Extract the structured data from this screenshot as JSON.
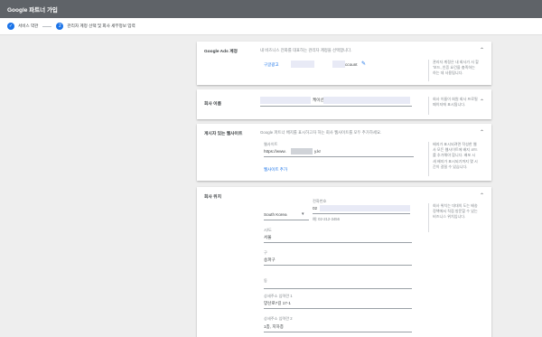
{
  "header": {
    "title": "Google 파트너 가입"
  },
  "steps": [
    {
      "num": "✓",
      "label": "서비스 약관"
    },
    {
      "num": "2",
      "label": "관리자 계정 선택 및 회사 세부정보 입력"
    }
  ],
  "ads_account": {
    "title": "Google Ads 계정",
    "desc": "내 비즈니스 전화를 대표하는 관리자 계정을 선택합니다.",
    "account_prefix": "구글광고",
    "account_suffix": "ccount",
    "help": "관리자 계정은 내 회사가 사 할 ‘보드, 인증 요건을 충족하는 하는 데 사용됩니다."
  },
  "company_name": {
    "title": "회사 이름",
    "value": "케이션",
    "help": "회사 이름이 회원 회사 프로필 페이지에 표시됩니다."
  },
  "websites": {
    "title": "게시자 있는 웹사이트",
    "desc": "Google 파트너 배지를 표시하고자 하는 회사 웹사이트를 모두 추가하세요.",
    "field_label": "웹사이트",
    "url_prefix": "https://www.",
    "url_suffix": "y.kr",
    "add_link": "웹사이트 추가",
    "help": "배지가 표시되려면 작성한 웹 사 모든 웹사이트에 배지 코드를 추가해야 합니다. 배포 시 새 배지가 표시되기까지 몇 시간이 걸릴 수 있습니다."
  },
  "location": {
    "title": "회사 위치",
    "country": "South Korea",
    "phone_label": "전화번호",
    "phone_prefix": "02",
    "phone_example": "예: 02-212-3456",
    "help": "회사 위치는 대대의 도는 배송 정책에서 직접 방문할 수 있는 비즈니스 위치입니다.",
    "fields": [
      {
        "label": "시/도",
        "value": "서울"
      },
      {
        "label": "구",
        "value": "송파구"
      },
      {
        "label": "동",
        "value": ""
      },
      {
        "label": "상세주소 입력란 1",
        "value": "양산로7길 17-1"
      },
      {
        "label": "상세주소 입력란 2",
        "value": "1층, 지하층"
      }
    ]
  },
  "colors": {
    "primary": "#1a73e8",
    "header_bg": "#5f6368",
    "page_bg": "#eeeeee"
  }
}
